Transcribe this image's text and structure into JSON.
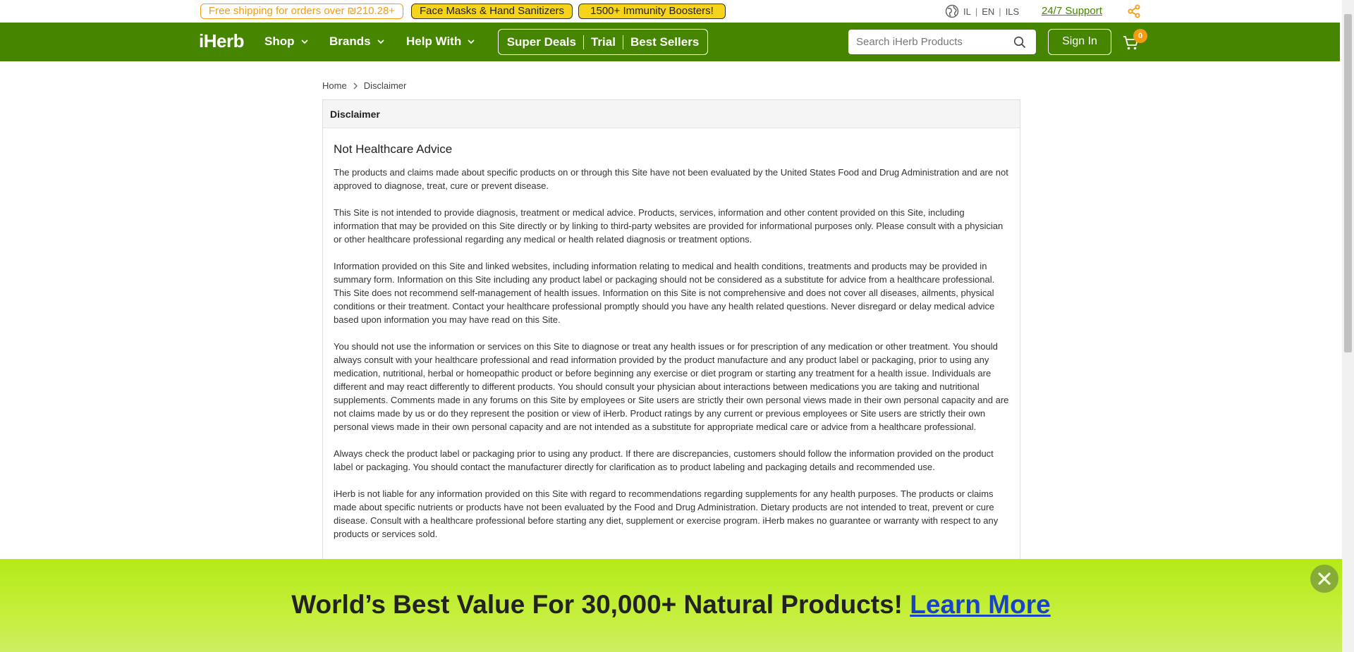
{
  "topbar": {
    "free_shipping": "Free shipping for orders over ₪210.28+",
    "masks": "Face Masks & Hand Sanitizers",
    "boosters": "1500+ Immunity Boosters!",
    "locale": {
      "country": "IL",
      "language": "EN",
      "currency": "ILS"
    },
    "support": "24/7 Support",
    "icons": {
      "globe": "globe-icon",
      "share": "share-icon"
    }
  },
  "header": {
    "logo": "iHerb",
    "nav": {
      "shop": "Shop",
      "brands": "Brands",
      "help": "Help With"
    },
    "deals": {
      "super_deals": "Super Deals",
      "trial": "Trial",
      "best_sellers": "Best Sellers"
    },
    "search": {
      "placeholder": "Search iHerb Products",
      "value": ""
    },
    "signin": "Sign In",
    "cart_count": "0",
    "brand_color": "#458500",
    "accent_color": "#f39c12"
  },
  "breadcrumb": {
    "home": "Home",
    "current": "Disclaimer"
  },
  "panel": {
    "header": "Disclaimer",
    "title": "Not Healthcare Advice",
    "paragraphs": [
      "The products and claims made about specific products on or through this Site have not been evaluated by the United States Food and Drug Administration and are not approved to diagnose, treat, cure or prevent disease.",
      "This Site is not intended to provide diagnosis, treatment or medical advice. Products, services, information and other content provided on this Site, including information that may be provided on this Site directly or by linking to third-party websites are provided for informational purposes only. Please consult with a physician or other healthcare professional regarding any medical or health related diagnosis or treatment options.",
      "Information provided on this Site and linked websites, including information relating to medical and health conditions, treatments and products may be provided in summary form. Information on this Site including any product label or packaging should not be considered as a substitute for advice from a healthcare professional. This Site does not recommend self-management of health issues. Information on this Site is not comprehensive and does not cover all diseases, ailments, physical conditions or their treatment. Contact your healthcare professional promptly should you have any health related questions. Never disregard or delay medical advice based upon information you may have read on this Site.",
      "You should not use the information or services on this Site to diagnose or treat any health issues or for prescription of any medication or other treatment. You should always consult with your healthcare professional and read information provided by the product manufacture and any product label or packaging, prior to using any medication, nutritional, herbal or homeopathic product or before beginning any exercise or diet program or starting any treatment for a health issue. Individuals are different and may react differently to different products. You should consult your physician about interactions between medications you are taking and nutritional supplements. Comments made in any forums on this Site by employees or Site users are strictly their own personal views made in their own personal capacity and are not claims made by us or do they represent the position or view of iHerb. Product ratings by any current or previous employees or Site users are strictly their own personal views made in their own personal capacity and are not intended as a substitute for appropriate medical care or advice from a healthcare professional.",
      "Always check the product label or packaging prior to using any product. If there are discrepancies, customers should follow the information provided on the product label or packaging. You should contact the manufacturer directly for clarification as to product labeling and packaging details and recommended use.",
      "iHerb is not liable for any information provided on this Site with regard to recommendations regarding supplements for any health purposes. The products or claims made about specific nutrients or products have not been evaluated by the Food and Drug Administration. Dietary products are not intended to treat, prevent or cure disease. Consult with a healthcare professional before starting any diet, supplement or exercise program. iHerb makes no guarantee or warranty with respect to any products or services sold."
    ]
  },
  "banner": {
    "text": "World’s Best Value For 30,000+ Natural Products!",
    "link": "Learn More",
    "close_icon": "close-icon"
  }
}
